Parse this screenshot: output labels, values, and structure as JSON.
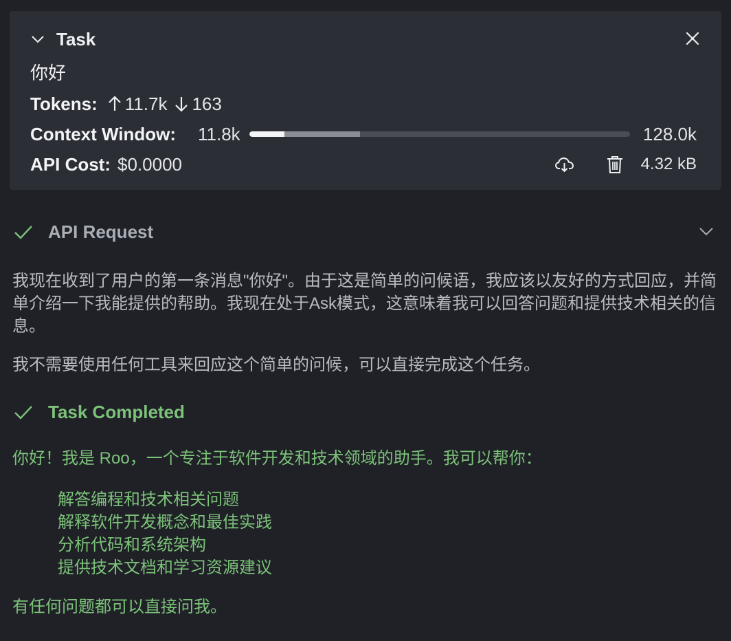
{
  "task": {
    "title": "Task",
    "text": "你好",
    "tokens_label": "Tokens:",
    "tokens_in": "11.7k",
    "tokens_out": "163",
    "context_label": "Context Window:",
    "context_used": "11.8k",
    "context_max": "128.0k",
    "context_used_fraction": 0.092,
    "context_reserved_fraction": 0.29,
    "cost_label": "API Cost:",
    "cost_value": "$0.0000",
    "size": "4.32 kB",
    "icons": [
      "chevron-down-icon",
      "close-icon",
      "arrow-up-icon",
      "arrow-down-icon",
      "cloud-download-icon",
      "trash-icon"
    ]
  },
  "api_request": {
    "title": "API Request",
    "status_icon": "check-icon",
    "paragraph1": "我现在收到了用户的第一条消息\"你好\"。由于这是简单的问候语，我应该以友好的方式回应，并简单介绍一下我能提供的帮助。我现在处于Ask模式，这意味着我可以回答问题和提供技术相关的信息。",
    "paragraph2": "我不需要使用任何工具来回应这个简单的问候，可以直接完成这个任务。"
  },
  "completion": {
    "title": "Task Completed",
    "intro": "你好！我是 Roo，一个专注于软件开发和技术领域的助手。我可以帮你：",
    "items": [
      "解答编程和技术相关问题",
      "解释软件开发概念和最佳实践",
      "分析代码和系统架构",
      "提供技术文档和学习资源建议"
    ],
    "outro": "有任何问题都可以直接问我。"
  },
  "colors": {
    "background": "#1f2127",
    "card": "#2b2e35",
    "success": "#7cc279",
    "muted_text": "#b8bbc2"
  }
}
